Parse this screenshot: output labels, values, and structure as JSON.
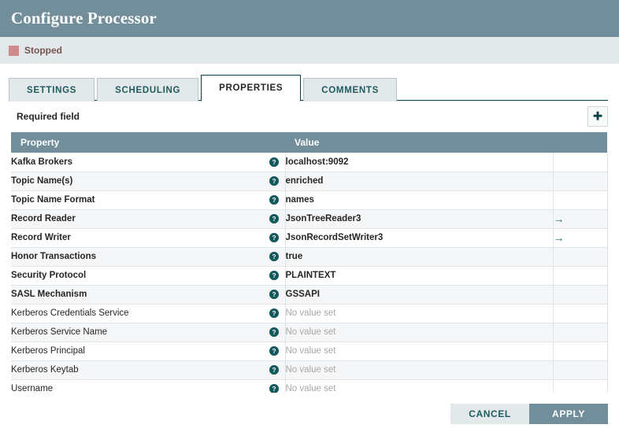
{
  "window": {
    "title": "Configure Processor"
  },
  "status": {
    "label": "Stopped",
    "color": "#cf8a8a"
  },
  "tabs": [
    {
      "label": "SETTINGS",
      "active": false
    },
    {
      "label": "SCHEDULING",
      "active": false
    },
    {
      "label": "PROPERTIES",
      "active": true
    },
    {
      "label": "COMMENTS",
      "active": false
    }
  ],
  "toolbar": {
    "required_field_label": "Required field",
    "add_property_icon": "plus-icon"
  },
  "table": {
    "columns": [
      "Property",
      "Value",
      ""
    ],
    "help_icon": "help-circle-icon",
    "go_to_icon": "arrow-right-icon",
    "unset_placeholder": "No value set",
    "rows": [
      {
        "property": "Kafka Brokers",
        "value": "localhost:9092",
        "required": true,
        "unset": false,
        "goto": false
      },
      {
        "property": "Topic Name(s)",
        "value": "enriched",
        "required": true,
        "unset": false,
        "goto": false
      },
      {
        "property": "Topic Name Format",
        "value": "names",
        "required": true,
        "unset": false,
        "goto": false
      },
      {
        "property": "Record Reader",
        "value": "JsonTreeReader3",
        "required": true,
        "unset": false,
        "goto": true
      },
      {
        "property": "Record Writer",
        "value": "JsonRecordSetWriter3",
        "required": true,
        "unset": false,
        "goto": true
      },
      {
        "property": "Honor Transactions",
        "value": "true",
        "required": true,
        "unset": false,
        "goto": false
      },
      {
        "property": "Security Protocol",
        "value": "PLAINTEXT",
        "required": true,
        "unset": false,
        "goto": false
      },
      {
        "property": "SASL Mechanism",
        "value": "GSSAPI",
        "required": true,
        "unset": false,
        "goto": false
      },
      {
        "property": "Kerberos Credentials Service",
        "value": "No value set",
        "required": false,
        "unset": true,
        "goto": false
      },
      {
        "property": "Kerberos Service Name",
        "value": "No value set",
        "required": false,
        "unset": true,
        "goto": false
      },
      {
        "property": "Kerberos Principal",
        "value": "No value set",
        "required": false,
        "unset": true,
        "goto": false
      },
      {
        "property": "Kerberos Keytab",
        "value": "No value set",
        "required": false,
        "unset": true,
        "goto": false
      },
      {
        "property": "Username",
        "value": "No value set",
        "required": false,
        "unset": true,
        "goto": false
      }
    ]
  },
  "footer": {
    "cancel_label": "CANCEL",
    "apply_label": "APPLY"
  },
  "colors": {
    "titlebar": "#728e9b",
    "status_strip": "#e3e8eb",
    "accent_teal": "#1e5c5c",
    "tab_border_active": "#053f43",
    "table_header": "#728e9b",
    "row_alt": "#f4f6f7"
  }
}
